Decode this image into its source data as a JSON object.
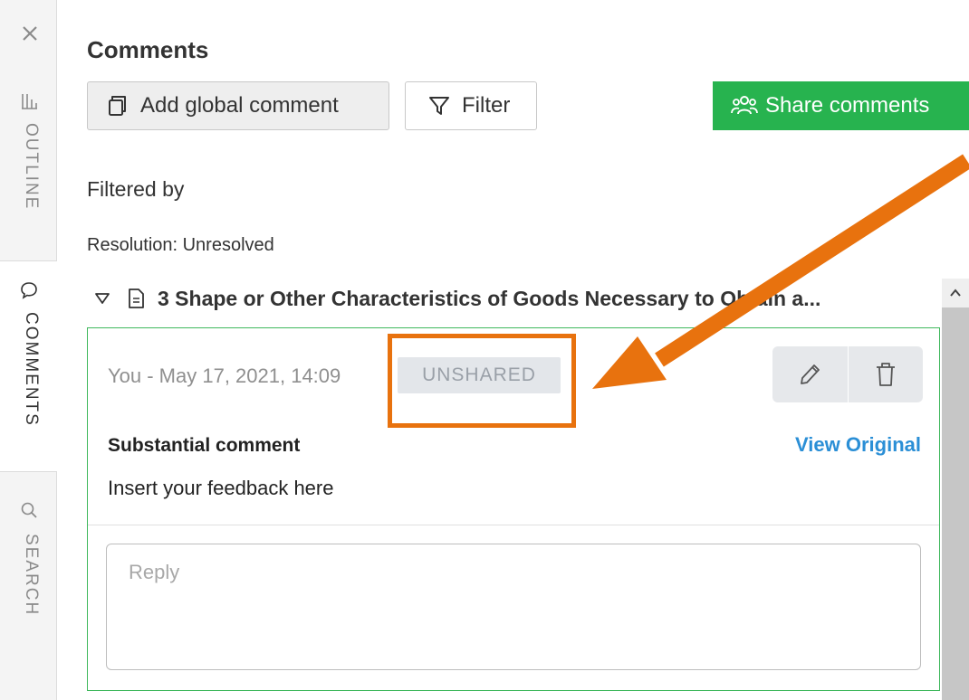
{
  "rail": {
    "tabs": [
      {
        "label": "OUTLINE",
        "icon": "outline-icon"
      },
      {
        "label": "COMMENTS",
        "icon": "comment-bubble-icon"
      },
      {
        "label": "SEARCH",
        "icon": "search-icon"
      }
    ]
  },
  "panel": {
    "title": "Comments",
    "add_global_label": "Add global comment",
    "filter_label": "Filter",
    "share_label": "Share comments",
    "filtered_by_label": "Filtered by",
    "resolution_filter": "Resolution:  Unresolved"
  },
  "section": {
    "title": "3 Shape or Other Characteristics of Goods Necessary to Obtain a..."
  },
  "comment": {
    "author_date": "You - May 17, 2021, 14:09",
    "status_badge": "UNSHARED",
    "type": "Substantial comment",
    "view_original_label": "View Original",
    "body": "Insert your feedback here",
    "reply_placeholder": "Reply"
  },
  "colors": {
    "share_green": "#27b34f",
    "card_border": "#3fb85c",
    "link_blue": "#2b8fd6",
    "annotation_orange": "#e8720e"
  }
}
